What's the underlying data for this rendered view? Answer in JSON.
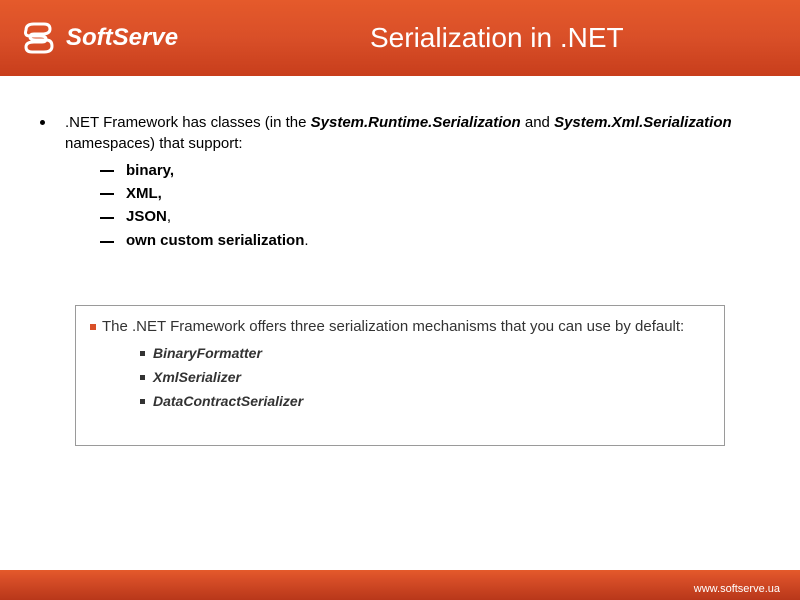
{
  "header": {
    "logo_text": "SoftServe",
    "title": "Serialization in .NET"
  },
  "main": {
    "intro_part1": ".NET Framework has classes (in the ",
    "intro_em1": "System.Runtime.Serialization",
    "intro_part2": " and ",
    "intro_em2": "System.Xml.Serialization",
    "intro_part3": " namespaces) that support:",
    "sub_items": {
      "item1": "binary,",
      "item2": "XML,",
      "item3": "JSON",
      "item3_tail": ",",
      "item4": "own custom serialization",
      "item4_tail": "."
    }
  },
  "info_box": {
    "intro": "The .NET Framework offers three serialization mechanisms that you can use by default:",
    "items": {
      "item1": "BinaryFormatter",
      "item2": "XmlSerializer",
      "item3": "DataContractSerializer"
    }
  },
  "footer": {
    "url": "www.softserve.ua"
  }
}
